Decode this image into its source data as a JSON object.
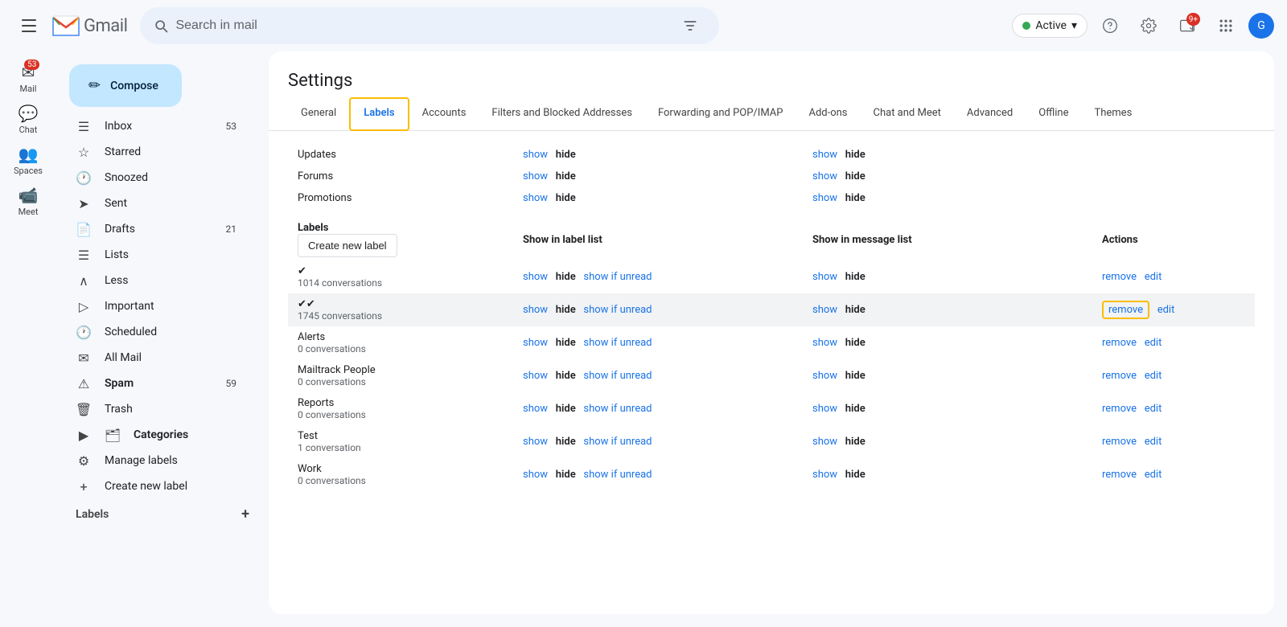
{
  "topbar": {
    "search_placeholder": "Search in mail",
    "active_label": "Active",
    "chevron": "▾"
  },
  "sidebar": {
    "compose_label": "Compose",
    "nav_items": [
      {
        "id": "inbox",
        "label": "Inbox",
        "count": "53",
        "icon": "☰"
      },
      {
        "id": "starred",
        "label": "Starred",
        "count": "",
        "icon": "☆"
      },
      {
        "id": "snoozed",
        "label": "Snoozed",
        "count": "",
        "icon": "🕐"
      },
      {
        "id": "sent",
        "label": "Sent",
        "count": "",
        "icon": "➤"
      },
      {
        "id": "drafts",
        "label": "Drafts",
        "count": "21",
        "icon": "📄"
      },
      {
        "id": "lists",
        "label": "Lists",
        "count": "",
        "icon": "☰"
      },
      {
        "id": "less",
        "label": "Less",
        "count": "",
        "icon": "∧"
      },
      {
        "id": "important",
        "label": "Important",
        "count": "",
        "icon": "▷"
      },
      {
        "id": "scheduled",
        "label": "Scheduled",
        "count": "",
        "icon": "🕐"
      },
      {
        "id": "all-mail",
        "label": "All Mail",
        "count": "",
        "icon": "✉"
      },
      {
        "id": "spam",
        "label": "Spam",
        "count": "59",
        "icon": "⚠"
      },
      {
        "id": "trash",
        "label": "Trash",
        "count": "",
        "icon": "🗑"
      }
    ],
    "categories_label": "Categories",
    "manage_labels": "Manage labels",
    "create_new_label": "Create new label",
    "labels_section": "Labels"
  },
  "left_icons": [
    {
      "id": "mail",
      "label": "Mail",
      "icon": "✉",
      "badge": "53"
    },
    {
      "id": "chat",
      "label": "Chat",
      "icon": "💬",
      "badge": ""
    },
    {
      "id": "spaces",
      "label": "Spaces",
      "icon": "👥",
      "badge": ""
    },
    {
      "id": "meet",
      "label": "Meet",
      "icon": "📹",
      "badge": ""
    }
  ],
  "settings": {
    "title": "Settings",
    "tabs": [
      {
        "id": "general",
        "label": "General",
        "active": false
      },
      {
        "id": "labels",
        "label": "Labels",
        "active": true
      },
      {
        "id": "accounts",
        "label": "Accounts",
        "active": false
      },
      {
        "id": "filters",
        "label": "Filters and Blocked Addresses",
        "active": false
      },
      {
        "id": "forwarding",
        "label": "Forwarding and POP/IMAP",
        "active": false
      },
      {
        "id": "addons",
        "label": "Add-ons",
        "active": false
      },
      {
        "id": "chat-meet",
        "label": "Chat and Meet",
        "active": false
      },
      {
        "id": "advanced",
        "label": "Advanced",
        "active": false
      },
      {
        "id": "offline",
        "label": "Offline",
        "active": false
      },
      {
        "id": "themes",
        "label": "Themes",
        "active": false
      }
    ]
  },
  "labels_table": {
    "sections": [
      {
        "type": "category-rows",
        "rows": [
          {
            "name": "Updates",
            "show_label_show": "show",
            "show_label_hide": "hide",
            "msg_show": "show",
            "msg_hide": "hide",
            "highlighted": false
          },
          {
            "name": "Forums",
            "show_label_show": "show",
            "show_label_hide": "hide",
            "msg_show": "show",
            "msg_hide": "hide",
            "highlighted": false
          },
          {
            "name": "Promotions",
            "show_label_show": "show",
            "show_label_hide": "hide",
            "msg_show": "show",
            "msg_hide": "hide",
            "highlighted": false
          }
        ]
      },
      {
        "type": "user-labels-header",
        "col1": "Labels",
        "col2": "Show in label list",
        "col3": "Show in message list",
        "col4": "Actions",
        "create_btn": "Create new label"
      },
      {
        "type": "user-label-rows",
        "rows": [
          {
            "id": "check1",
            "name": "✔",
            "conversations": "1014 conversations",
            "label_show": "show",
            "label_hide": "hide",
            "label_showifunread": "show if unread",
            "msg_show": "show",
            "msg_hide": "hide",
            "remove": "remove",
            "edit": "edit",
            "highlighted": false
          },
          {
            "id": "check2",
            "name": "✔✔",
            "conversations": "1745 conversations",
            "label_show": "show",
            "label_hide": "hide",
            "label_showifunread": "show if unread",
            "msg_show": "show",
            "msg_hide": "hide",
            "remove": "remove",
            "edit": "edit",
            "highlighted": true
          },
          {
            "id": "alerts",
            "name": "Alerts",
            "conversations": "0 conversations",
            "label_show": "show",
            "label_hide": "hide",
            "label_showifunread": "show if unread",
            "msg_show": "show",
            "msg_hide": "hide",
            "remove": "remove",
            "edit": "edit",
            "highlighted": false
          },
          {
            "id": "mailtrack",
            "name": "Mailtrack People",
            "conversations": "0 conversations",
            "label_show": "show",
            "label_hide": "hide",
            "label_showifunread": "show if unread",
            "msg_show": "show",
            "msg_hide": "hide",
            "remove": "remove",
            "edit": "edit",
            "highlighted": false
          },
          {
            "id": "reports",
            "name": "Reports",
            "conversations": "0 conversations",
            "label_show": "show",
            "label_hide": "hide",
            "label_showifunread": "show if unread",
            "msg_show": "show",
            "msg_hide": "hide",
            "remove": "remove",
            "edit": "edit",
            "highlighted": false
          },
          {
            "id": "test",
            "name": "Test",
            "conversations": "1 conversation",
            "label_show": "show",
            "label_hide": "hide",
            "label_showifunread": "show if unread",
            "msg_show": "show",
            "msg_hide": "hide",
            "remove": "remove",
            "edit": "edit",
            "highlighted": false
          },
          {
            "id": "work",
            "name": "Work",
            "conversations": "0 conversations",
            "label_show": "show",
            "label_hide": "hide",
            "label_showifunread": "show if unread",
            "msg_show": "show",
            "msg_hide": "hide",
            "remove": "remove",
            "edit": "edit",
            "highlighted": false
          }
        ]
      }
    ]
  }
}
